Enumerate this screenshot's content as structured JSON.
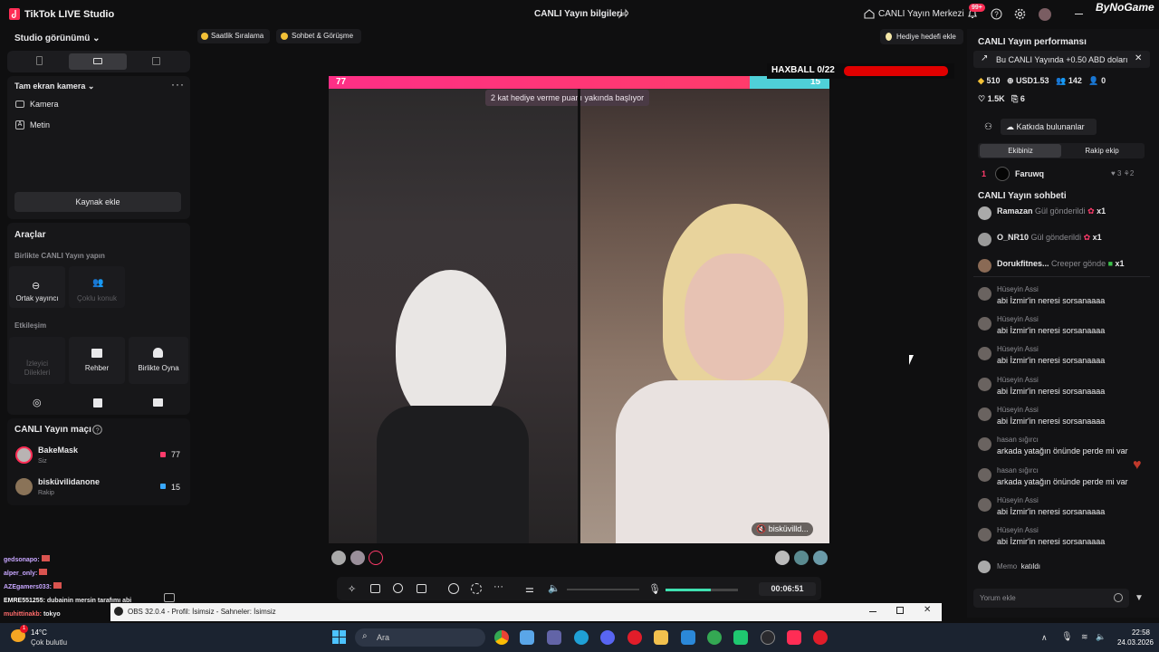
{
  "app": {
    "title": "TikTok LIVE Studio",
    "center_title": "CANLI Yayın bilgileri",
    "live_center": "CANLI Yayın Merkezi",
    "notif_badge": "99+",
    "watermark": "ByNoGame"
  },
  "left": {
    "studio_view": "Studio görünümü",
    "scene_title": "Tam ekran kamera",
    "sources": [
      {
        "icon": "camera-icon",
        "label": "Kamera"
      },
      {
        "icon": "text-icon",
        "label": "Metin"
      }
    ],
    "add_source": "Kaynak ekle",
    "tools_title": "Araçlar",
    "together_title": "Birlikte CANLI Yayın yapın",
    "together_items": [
      {
        "label": "Ortak yayıncı",
        "enabled": true
      },
      {
        "label": "Çoklu konuk",
        "enabled": false
      }
    ],
    "interaction_title": "Etkileşim",
    "interaction_items": [
      {
        "label": "İzleyici Dilekleri",
        "enabled": false
      },
      {
        "label": "Rehber",
        "enabled": true
      },
      {
        "label": "Birlikte Oyna",
        "enabled": true
      }
    ],
    "match_title": "CANLI Yayın maçı",
    "match": [
      {
        "name": "BakeMask",
        "sub": "Siz",
        "score": "77",
        "color": "#ff3b6b"
      },
      {
        "name": "bisküvilidanone",
        "sub": "Rakip",
        "score": "15",
        "color": "#39a8ff"
      }
    ],
    "overlay_chat": [
      {
        "name": "gedsonapo:",
        "msg": "",
        "color": "#c7a6ff"
      },
      {
        "name": "alper_only:",
        "msg": "",
        "color": "#c7a6ff"
      },
      {
        "name": "AZEgamers033:",
        "msg": "",
        "color": "#c7a6ff"
      },
      {
        "name": "EMRE551255:",
        "msg": "dubainin mersin tarafımı abi",
        "color": "#ffffff"
      },
      {
        "name": "muhittinakb:",
        "msg": "tokyo",
        "color": "#ff6b6b"
      }
    ]
  },
  "top_chips": [
    {
      "label": "Saatlik Sıralama"
    },
    {
      "label": "Sohbet & Görüşme"
    }
  ],
  "gift_goal": "Hediye hedefi ekle",
  "battle": {
    "score_left": "77",
    "score_right": "15",
    "left_share": 0.84,
    "banner": "2 kat hediye verme puanı yakında başlıyor",
    "haxball": "HAXBALL 0/22",
    "haxball_progress": 0,
    "opponent_tag": "bisküvilld..."
  },
  "controls": {
    "time": "00:06:51",
    "mic_level": 0.62
  },
  "right": {
    "perf_title": "CANLI Yayın performansı",
    "earn_text": "Bu CANLI Yayında +0.50 ABD doları",
    "stats": [
      {
        "icon": "diamond-icon",
        "value": "510"
      },
      {
        "icon": "coin-icon",
        "value": "USD1.53"
      },
      {
        "icon": "viewers-icon",
        "value": "142"
      },
      {
        "icon": "follow-icon",
        "value": "0"
      },
      {
        "icon": "heart-icon",
        "value": "1.5K"
      },
      {
        "icon": "share-icon",
        "value": "6"
      }
    ],
    "contributors": "Katkıda bulunanlar",
    "tabs": [
      "Ekibiniz",
      "Rakip ekip"
    ],
    "rank": {
      "num": "1",
      "name": "Faruwq",
      "hearts": "3",
      "gifts": "2"
    },
    "chat_title": "CANLI Yayın sohbeti",
    "gifts": [
      {
        "name": "Ramazan",
        "action": "Gül gönderildi",
        "count": "x1"
      },
      {
        "name": "O_NR10",
        "action": "Gül gönderildi",
        "count": "x1"
      },
      {
        "name": "Dorukfitnes...",
        "action": "Creeper gönde",
        "count": "x1"
      }
    ],
    "chat": [
      {
        "name": "Hüseyin Assi",
        "msg": "abi İzmir'in neresi sorsanaaaa"
      },
      {
        "name": "Hüseyin Assi",
        "msg": "abi İzmir'in neresi sorsanaaaa"
      },
      {
        "name": "Hüseyin Assi",
        "msg": "abi İzmir'in neresi sorsanaaaa"
      },
      {
        "name": "Hüseyin Assi",
        "msg": "abi İzmir'in neresi sorsanaaaa"
      },
      {
        "name": "Hüseyin Assi",
        "msg": "abi İzmir'in neresi sorsanaaaa"
      },
      {
        "name": "hasan sığırcı",
        "msg": "arkada yatağın önünde perde mi var"
      },
      {
        "name": "hasan sığırcı",
        "msg": "arkada yatağın önünde perde mi var"
      },
      {
        "name": "Hüseyin Assi",
        "msg": "abi İzmir'in neresi sorsanaaaa"
      },
      {
        "name": "Hüseyin Assi",
        "msg": "abi İzmir'in neresi sorsanaaaa"
      }
    ],
    "joined_name": "Memo",
    "joined_text": "katıldı",
    "comment_placeholder": "Yorum ekle"
  },
  "obs": {
    "title": "OBS 32.0.4 - Profil: İsimsiz - Sahneler: İsimsiz"
  },
  "taskbar": {
    "temp": "14°C",
    "weather": "Çok bulutlu",
    "search": "Ara",
    "time": "22:58",
    "date": "24.03.2026"
  }
}
